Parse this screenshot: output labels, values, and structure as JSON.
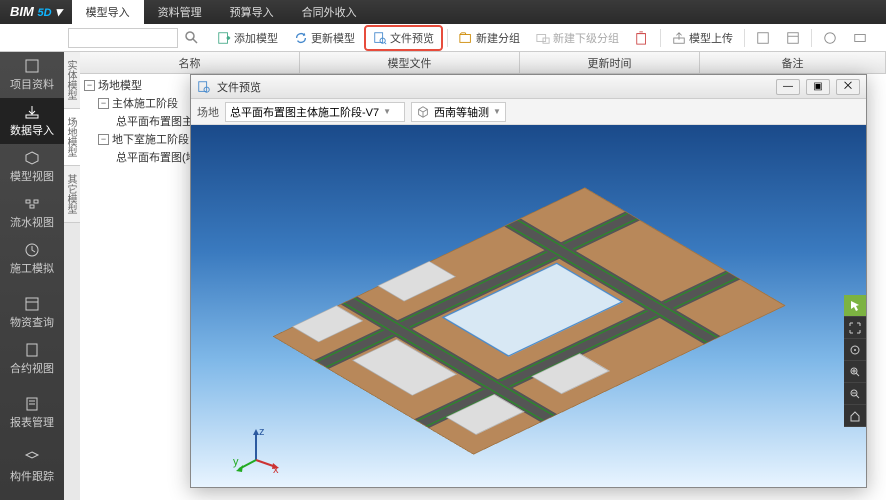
{
  "app": {
    "name": "BIM 5D"
  },
  "menu": {
    "items": [
      "模型导入",
      "资料管理",
      "预算导入",
      "合同外收入"
    ],
    "active": 0
  },
  "toolbar": {
    "search_placeholder": "",
    "buttons": [
      {
        "id": "add-model",
        "label": "添加模型"
      },
      {
        "id": "update-model",
        "label": "更新模型"
      },
      {
        "id": "file-preview",
        "label": "文件预览",
        "highlighted": true
      },
      {
        "id": "new-group",
        "label": "新建分组"
      },
      {
        "id": "new-subgroup",
        "label": "新建下级分组"
      },
      {
        "id": "model-upload",
        "label": "模型上传"
      }
    ]
  },
  "sidebar": {
    "items": [
      {
        "id": "project-data",
        "label": "项目资料"
      },
      {
        "id": "data-import",
        "label": "数据导入",
        "active": true
      },
      {
        "id": "model-view",
        "label": "模型视图"
      },
      {
        "id": "flow-view",
        "label": "流水视图"
      },
      {
        "id": "construction-sim",
        "label": "施工模拟"
      },
      {
        "id": "material-query",
        "label": "物资查询"
      },
      {
        "id": "contract-view",
        "label": "合约视图"
      },
      {
        "id": "report-mgmt",
        "label": "报表管理"
      },
      {
        "id": "component-track",
        "label": "构件跟踪"
      }
    ]
  },
  "vtabs": {
    "items": [
      "实体模型",
      "场地模型",
      "其它模型"
    ],
    "active": 1
  },
  "columns": [
    "名称",
    "模型文件",
    "更新时间",
    "备注"
  ],
  "tree": [
    {
      "level": 0,
      "expand": "-",
      "label": "场地模型"
    },
    {
      "level": 1,
      "expand": "-",
      "label": "主体施工阶段"
    },
    {
      "level": 2,
      "expand": "",
      "label": "总平面布置图主体施工阶段"
    },
    {
      "level": 1,
      "expand": "-",
      "label": "地下室施工阶段"
    },
    {
      "level": 2,
      "expand": "",
      "label": "总平面布置图(地下室施工阶段)"
    }
  ],
  "preview": {
    "title": "文件预览",
    "field_label": "场地",
    "select_value": "总平面布置图主体施工阶段-V7",
    "view_label": "西南等轴测"
  },
  "right_tools": [
    "cursor",
    "fullscreen",
    "rotate",
    "zoom-in",
    "zoom-out",
    "home"
  ]
}
